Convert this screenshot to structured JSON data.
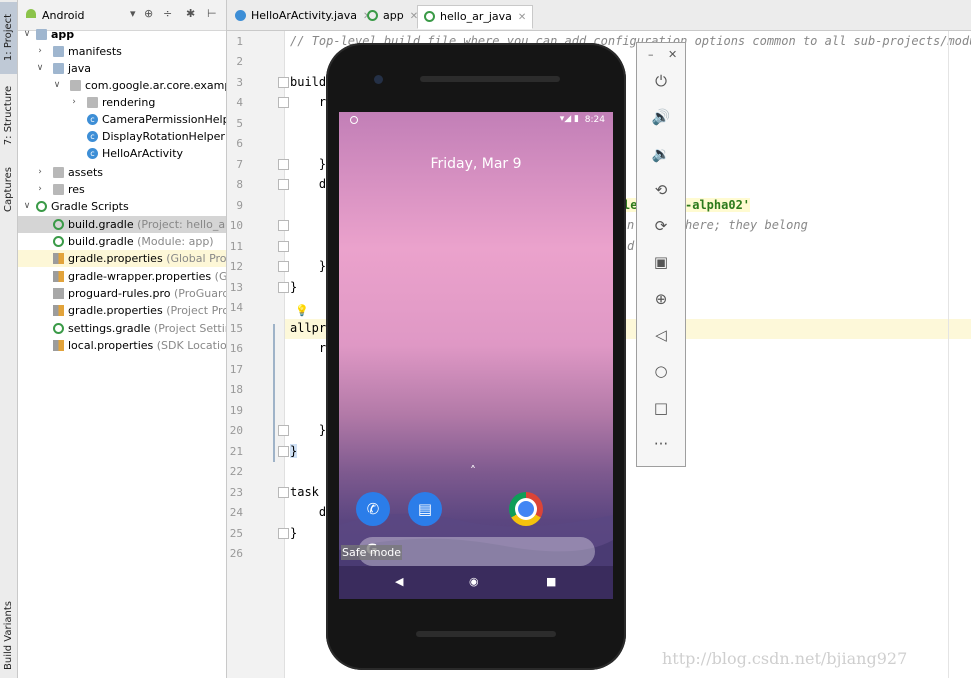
{
  "tool_strip": {
    "project_tab": "1: Project",
    "structure_tab": "7: Structure",
    "captures_tab": "Captures",
    "build_variants_tab": "Build Variants"
  },
  "project_panel": {
    "view_mode": "Android",
    "tree": [
      {
        "label": "app",
        "sub": ""
      },
      {
        "label": "manifests",
        "sub": ""
      },
      {
        "label": "java",
        "sub": ""
      },
      {
        "label": "com.google.ar.core.examples",
        "sub": ""
      },
      {
        "label": "rendering",
        "sub": ""
      },
      {
        "label": "CameraPermissionHelper",
        "sub": ""
      },
      {
        "label": "DisplayRotationHelper",
        "sub": ""
      },
      {
        "label": "HelloArActivity",
        "sub": ""
      },
      {
        "label": "assets",
        "sub": ""
      },
      {
        "label": "res",
        "sub": ""
      },
      {
        "label": "Gradle Scripts",
        "sub": ""
      },
      {
        "label": "build.gradle",
        "sub": "(Project: hello_ar_jav"
      },
      {
        "label": "build.gradle",
        "sub": "(Module: app)"
      },
      {
        "label": "gradle.properties",
        "sub": "(Global Proper"
      },
      {
        "label": "gradle-wrapper.properties",
        "sub": "(Grad"
      },
      {
        "label": "proguard-rules.pro",
        "sub": "(ProGuard R"
      },
      {
        "label": "gradle.properties",
        "sub": "(Project Prope"
      },
      {
        "label": "settings.gradle",
        "sub": "(Project Settings)"
      },
      {
        "label": "local.properties",
        "sub": "(SDK Location)"
      }
    ]
  },
  "editor": {
    "tabs": [
      {
        "label": "HelloArActivity.java"
      },
      {
        "label": "app"
      },
      {
        "label": "hello_ar_java"
      }
    ],
    "line_numbers": [
      "1",
      "2",
      "3",
      "4",
      "5",
      "6",
      "7",
      "8",
      "9",
      "10",
      "11",
      "12",
      "13",
      "14",
      "15",
      "16",
      "17",
      "18",
      "19",
      "20",
      "21",
      "22",
      "23",
      "24",
      "25",
      "26"
    ],
    "code": {
      "l1": "// Top-level build file where you can add configuration options common to all sub-projects/modules.",
      "l3": "builds",
      "l4": "    re",
      "l7": "    }",
      "l8": "    de",
      "l9_str": "le",
      "l9_str2": "-alpha02'",
      "l10a": "n",
      "l10b": "here; they belong",
      "l11": "d",
      "l12": "    }",
      "l13": "}",
      "l15": "allpro",
      "l16": "    re",
      "l20": "    }",
      "l21": "}",
      "l23": "task c",
      "l24": "    de",
      "l25": "}"
    }
  },
  "emulator": {
    "status_time": "8:24",
    "lock_date": "Friday, Mar 9",
    "safe_mode_label": "Safe mode",
    "search_logo": "G",
    "controls": [
      "power",
      "volume-up",
      "volume-down",
      "rotate-left",
      "rotate-right",
      "screenshot",
      "zoom",
      "back",
      "home",
      "overview",
      "more"
    ]
  },
  "watermark": "http://blog.csdn.net/bjiang927",
  "colors": {
    "selection": "#d5d5d5",
    "line_highlight": "#fdf8d9",
    "wallpaper_top": "#eba2cc",
    "wallpaper_bottom": "#4b3b75"
  }
}
